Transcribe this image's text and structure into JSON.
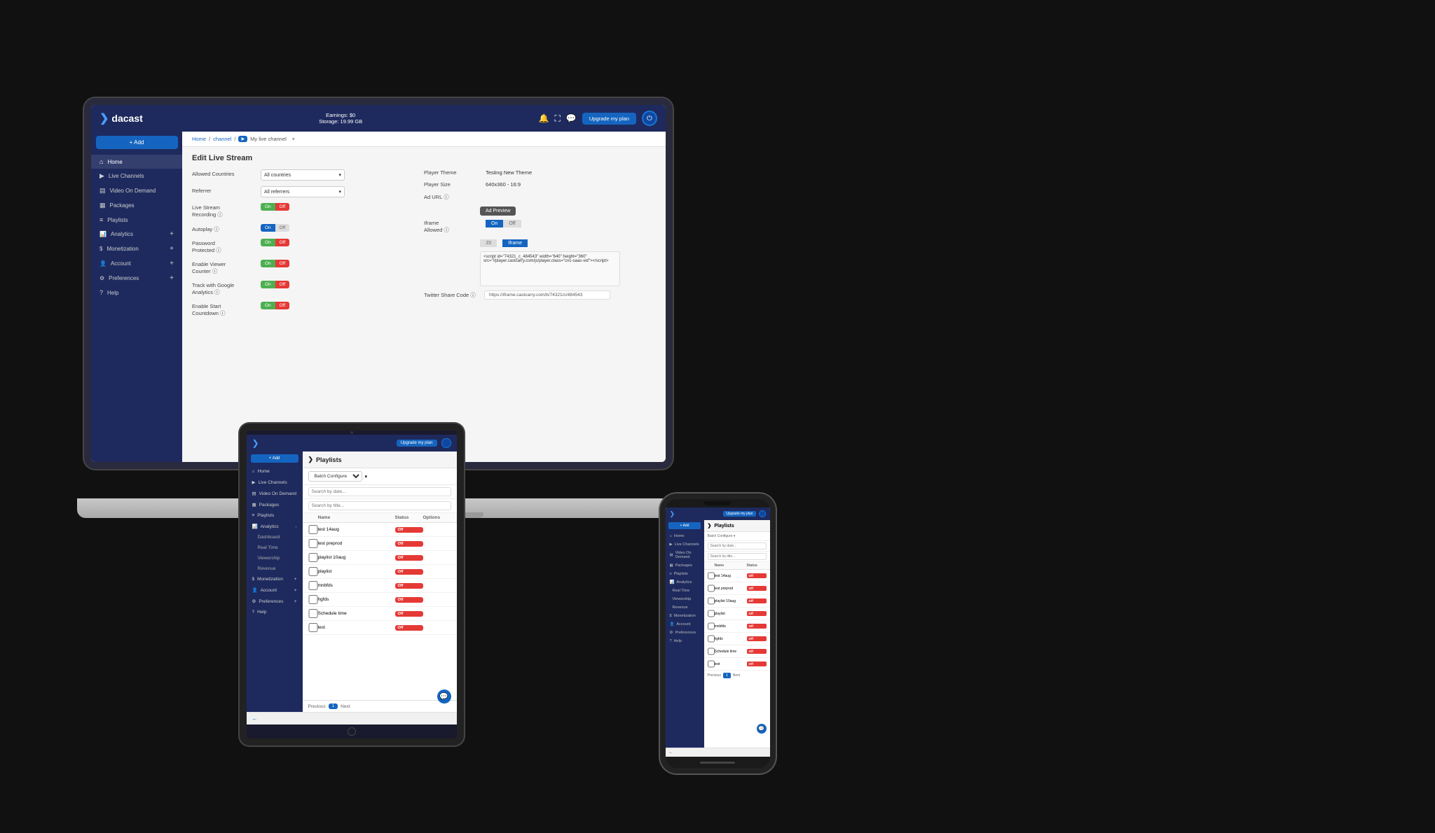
{
  "laptop": {
    "header": {
      "logo": "dacast",
      "earnings": "Earnings: $0",
      "storage": "Storage: 19.99 GB",
      "upgrade_label": "Upgrade my plan"
    },
    "sidebar": {
      "add_label": "+ Add",
      "items": [
        {
          "label": "Home",
          "icon": "⌂"
        },
        {
          "label": "Live Channels",
          "icon": "▶"
        },
        {
          "label": "Video On Demand",
          "icon": "▤"
        },
        {
          "label": "Packages",
          "icon": "📦"
        },
        {
          "label": "Playlists",
          "icon": "≡"
        },
        {
          "label": "Analytics",
          "icon": "📊"
        },
        {
          "label": "Monetization",
          "icon": "💲"
        },
        {
          "label": "Account",
          "icon": "👤"
        },
        {
          "label": "Preferences",
          "icon": "⚙"
        },
        {
          "label": "Help",
          "icon": "?"
        }
      ]
    },
    "breadcrumb": {
      "home": "Home",
      "channel": "channel",
      "page": "My live channel"
    },
    "page_title": "Edit Live Stream",
    "form": {
      "allowed_countries_label": "Allowed Countries",
      "allowed_countries_value": "All countries",
      "referrer_label": "Referrer",
      "referrer_value": "All referrers",
      "live_stream_label": "Live Stream Recording",
      "autoplay_label": "Autoplay",
      "password_label": "Password Protected",
      "viewer_counter_label": "Enable Viewer Counter",
      "google_analytics_label": "Track with Google Analytics",
      "start_countdown_label": "Enable Start Countdown",
      "player_theme_label": "Player Theme",
      "player_theme_value": "Testing New Theme",
      "player_size_label": "Player Size",
      "player_size_value": "640x360 - 16:9",
      "ad_url_label": "Ad URL",
      "ad_preview_label": "Ad Preview",
      "iframe_allowed_label": "Iframe Allowed",
      "js_tab": "JS",
      "iframe_tab": "Iframe",
      "code_snippet": "<script id=\"74321_c_484543\" width=\"640\" height=\"360\" src=\"//player.castcarry.com/js/player.class=\"cnc-saas-vid\"></script>",
      "twitter_label": "Twitter Share Code",
      "twitter_url": "https://iframe.castcarry.com/b/74321/c/484543",
      "on_label": "On",
      "off_label": "Off"
    }
  },
  "tablet": {
    "header": {
      "upgrade_label": "Upgrade my plan"
    },
    "sidebar": {
      "add_label": "+ Add",
      "items": [
        "Home",
        "Live Channels",
        "Video On Demand",
        "Packages",
        "Playlists",
        "Analytics",
        "Monetization",
        "Account",
        "Preferences",
        "Help"
      ]
    },
    "playlists": {
      "title": "Playlists",
      "batch_configure": "Batch Configure",
      "search_date_placeholder": "Search by date...",
      "search_title_placeholder": "Search by title...",
      "table_headers": [
        "",
        "Name",
        "Status",
        "Options"
      ],
      "rows": [
        {
          "name": "test 14aug",
          "status": "Off"
        },
        {
          "name": "test preprod",
          "status": "Off"
        },
        {
          "name": "playlist 10aug",
          "status": "Off"
        },
        {
          "name": "playlist",
          "status": "Off"
        },
        {
          "name": "mnbfds",
          "status": "Off"
        },
        {
          "name": "hgfds",
          "status": "Off"
        },
        {
          "name": "Schedule time",
          "status": "Off"
        },
        {
          "name": "test",
          "status": "Off"
        }
      ],
      "pagination": {
        "previous": "Previous",
        "page": "1",
        "next": "Next"
      }
    }
  },
  "phone": {
    "playlists": {
      "title": "Playlists",
      "rows": [
        {
          "name": "test 14aug",
          "status": "Off"
        },
        {
          "name": "test preprod",
          "status": "Off"
        },
        {
          "name": "playlist 10aug",
          "status": "Off"
        },
        {
          "name": "playlist",
          "status": "Off"
        },
        {
          "name": "mnbfds",
          "status": "Off"
        },
        {
          "name": "hgfds",
          "status": "Off"
        },
        {
          "name": "Schedule time",
          "status": "Off"
        },
        {
          "name": "test",
          "status": "Off"
        }
      ]
    }
  }
}
